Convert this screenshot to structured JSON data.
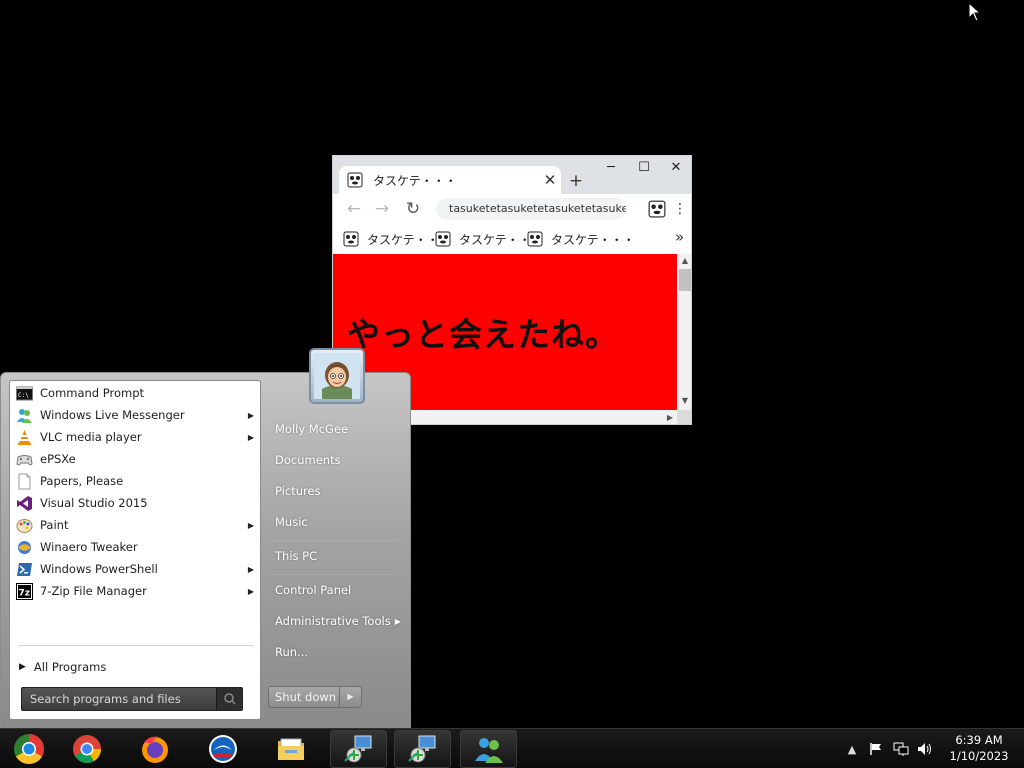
{
  "browser": {
    "tab_title": "タスケテ・・・",
    "new_tab_label": "+",
    "url": "tasuketetasuketetasuketetasukete",
    "bookmarks": [
      "タスケテ・・・",
      "タスケテ・・・",
      "タスケテ・・・"
    ],
    "page_text": "やっと会えたね。",
    "page_background": "#ff0000"
  },
  "start_menu": {
    "programs": [
      {
        "label": "Command Prompt",
        "icon": "command-prompt-icon",
        "has_submenu": false
      },
      {
        "label": "Windows Live Messenger",
        "icon": "messenger-icon",
        "has_submenu": true
      },
      {
        "label": "VLC media player",
        "icon": "vlc-icon",
        "has_submenu": true
      },
      {
        "label": "ePSXe",
        "icon": "gamepad-icon",
        "has_submenu": false
      },
      {
        "label": "Papers, Please",
        "icon": "document-icon",
        "has_submenu": false
      },
      {
        "label": "Visual Studio 2015",
        "icon": "visual-studio-icon",
        "has_submenu": false
      },
      {
        "label": "Paint",
        "icon": "paint-icon",
        "has_submenu": true
      },
      {
        "label": "Winaero Tweaker",
        "icon": "tweaker-icon",
        "has_submenu": false
      },
      {
        "label": "Windows PowerShell",
        "icon": "powershell-icon",
        "has_submenu": true
      },
      {
        "label": "7-Zip File Manager",
        "icon": "7zip-icon",
        "has_submenu": true
      }
    ],
    "all_programs_label": "All Programs",
    "search_placeholder": "Search programs and files",
    "right_links": [
      {
        "label": "Molly McGee"
      },
      {
        "label": "Documents"
      },
      {
        "label": "Pictures"
      },
      {
        "label": "Music"
      },
      {
        "label": "This PC"
      },
      {
        "label": "Control Panel"
      },
      {
        "label": "Administrative Tools",
        "has_submenu": true
      },
      {
        "label": "Run..."
      }
    ],
    "shutdown_label": "Shut down"
  },
  "taskbar": {
    "buttons": [
      {
        "icon": "start-orb-icon"
      },
      {
        "icon": "chrome-icon"
      },
      {
        "icon": "firefox-icon"
      },
      {
        "icon": "edge-icon"
      },
      {
        "icon": "file-explorer-icon"
      },
      {
        "icon": "network-setup-icon"
      },
      {
        "icon": "network-setup-icon"
      },
      {
        "icon": "messenger-icon"
      }
    ],
    "clock_time": "6:39 AM",
    "clock_date": "1/10/2023"
  },
  "colors": {
    "desktop": "#000000",
    "start_menu_right": "#a4a4a4",
    "taskbar": "#111111"
  }
}
